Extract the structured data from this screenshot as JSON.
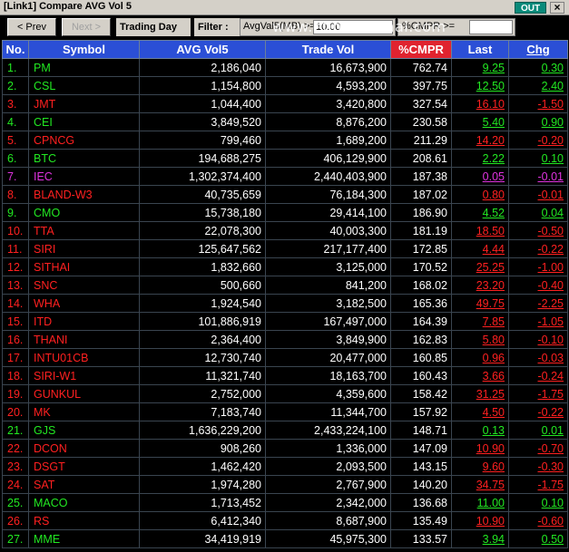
{
  "window": {
    "title": "[Link1] Compare AVG Vol 5",
    "out_label": "OUT",
    "close_label": "×"
  },
  "toolbar": {
    "prev_label": "< Prev",
    "next_label": "Next >",
    "trading_day_label": "Trading Day",
    "filter_label": "Filter :",
    "filter_field": "AvgVal5(MB) >=",
    "filter_value": "10.00",
    "cmpr_label": "%CMPR >=",
    "cmpr_value": "",
    "watermark": "www.efinancethai.com"
  },
  "colors": {
    "up": "#22e822",
    "down": "#ff2020",
    "floor": "#e033e0",
    "header": "#2b4fd6",
    "sorted_header": "#e0232f"
  },
  "table": {
    "headers": {
      "no": "No.",
      "symbol": "Symbol",
      "avg_vol5": "AVG Vol5",
      "trade_vol": "Trade Vol",
      "cmpr": "%CMPR",
      "last": "Last",
      "chg": "Chg"
    },
    "rows": [
      {
        "no": "1.",
        "symbol": "PM",
        "avg": "2,186,040",
        "vol": "16,673,900",
        "cmpr": "762.74",
        "last": "9.25",
        "chg": "0.30",
        "dir": "up"
      },
      {
        "no": "2.",
        "symbol": "CSL",
        "avg": "1,154,800",
        "vol": "4,593,200",
        "cmpr": "397.75",
        "last": "12.50",
        "chg": "2.40",
        "dir": "up"
      },
      {
        "no": "3.",
        "symbol": "JMT",
        "avg": "1,044,400",
        "vol": "3,420,800",
        "cmpr": "327.54",
        "last": "16.10",
        "chg": "-1.50",
        "dir": "down"
      },
      {
        "no": "4.",
        "symbol": "CEI",
        "avg": "3,849,520",
        "vol": "8,876,200",
        "cmpr": "230.58",
        "last": "5.40",
        "chg": "0.90",
        "dir": "up"
      },
      {
        "no": "5.",
        "symbol": "CPNCG",
        "avg": "799,460",
        "vol": "1,689,200",
        "cmpr": "211.29",
        "last": "14.20",
        "chg": "-0.20",
        "dir": "down"
      },
      {
        "no": "6.",
        "symbol": "BTC",
        "avg": "194,688,275",
        "vol": "406,129,900",
        "cmpr": "208.61",
        "last": "2.22",
        "chg": "0.10",
        "dir": "up"
      },
      {
        "no": "7.",
        "symbol": "IEC",
        "avg": "1,302,374,400",
        "vol": "2,440,403,900",
        "cmpr": "187.38",
        "last": "0.05",
        "chg": "-0.01",
        "dir": "floor"
      },
      {
        "no": "8.",
        "symbol": "BLAND-W3",
        "avg": "40,735,659",
        "vol": "76,184,300",
        "cmpr": "187.02",
        "last": "0.80",
        "chg": "-0.01",
        "dir": "down"
      },
      {
        "no": "9.",
        "symbol": "CMO",
        "avg": "15,738,180",
        "vol": "29,414,100",
        "cmpr": "186.90",
        "last": "4.52",
        "chg": "0.04",
        "dir": "up"
      },
      {
        "no": "10.",
        "symbol": "TTA",
        "avg": "22,078,300",
        "vol": "40,003,300",
        "cmpr": "181.19",
        "last": "18.50",
        "chg": "-0.50",
        "dir": "down"
      },
      {
        "no": "11.",
        "symbol": "SIRI",
        "avg": "125,647,562",
        "vol": "217,177,400",
        "cmpr": "172.85",
        "last": "4.44",
        "chg": "-0.22",
        "dir": "down"
      },
      {
        "no": "12.",
        "symbol": "SITHAI",
        "avg": "1,832,660",
        "vol": "3,125,000",
        "cmpr": "170.52",
        "last": "25.25",
        "chg": "-1.00",
        "dir": "down"
      },
      {
        "no": "13.",
        "symbol": "SNC",
        "avg": "500,660",
        "vol": "841,200",
        "cmpr": "168.02",
        "last": "23.20",
        "chg": "-0.40",
        "dir": "down"
      },
      {
        "no": "14.",
        "symbol": "WHA",
        "avg": "1,924,540",
        "vol": "3,182,500",
        "cmpr": "165.36",
        "last": "49.75",
        "chg": "-2.25",
        "dir": "down"
      },
      {
        "no": "15.",
        "symbol": "ITD",
        "avg": "101,886,919",
        "vol": "167,497,000",
        "cmpr": "164.39",
        "last": "7.85",
        "chg": "-1.05",
        "dir": "down"
      },
      {
        "no": "16.",
        "symbol": "THANI",
        "avg": "2,364,400",
        "vol": "3,849,900",
        "cmpr": "162.83",
        "last": "5.80",
        "chg": "-0.10",
        "dir": "down"
      },
      {
        "no": "17.",
        "symbol": "INTU01CB",
        "avg": "12,730,740",
        "vol": "20,477,000",
        "cmpr": "160.85",
        "last": "0.96",
        "chg": "-0.03",
        "dir": "down"
      },
      {
        "no": "18.",
        "symbol": "SIRI-W1",
        "avg": "11,321,740",
        "vol": "18,163,700",
        "cmpr": "160.43",
        "last": "3.66",
        "chg": "-0.24",
        "dir": "down"
      },
      {
        "no": "19.",
        "symbol": "GUNKUL",
        "avg": "2,752,000",
        "vol": "4,359,600",
        "cmpr": "158.42",
        "last": "31.25",
        "chg": "-1.75",
        "dir": "down"
      },
      {
        "no": "20.",
        "symbol": "MK",
        "avg": "7,183,740",
        "vol": "11,344,700",
        "cmpr": "157.92",
        "last": "4.50",
        "chg": "-0.22",
        "dir": "down"
      },
      {
        "no": "21.",
        "symbol": "GJS",
        "avg": "1,636,229,200",
        "vol": "2,433,224,100",
        "cmpr": "148.71",
        "last": "0.13",
        "chg": "0.01",
        "dir": "up"
      },
      {
        "no": "22.",
        "symbol": "DCON",
        "avg": "908,260",
        "vol": "1,336,000",
        "cmpr": "147.09",
        "last": "10.90",
        "chg": "-0.70",
        "dir": "down"
      },
      {
        "no": "23.",
        "symbol": "DSGT",
        "avg": "1,462,420",
        "vol": "2,093,500",
        "cmpr": "143.15",
        "last": "9.60",
        "chg": "-0.30",
        "dir": "down"
      },
      {
        "no": "24.",
        "symbol": "SAT",
        "avg": "1,974,280",
        "vol": "2,767,900",
        "cmpr": "140.20",
        "last": "34.75",
        "chg": "-1.75",
        "dir": "down"
      },
      {
        "no": "25.",
        "symbol": "MACO",
        "avg": "1,713,452",
        "vol": "2,342,000",
        "cmpr": "136.68",
        "last": "11.00",
        "chg": "0.10",
        "dir": "up"
      },
      {
        "no": "26.",
        "symbol": "RS",
        "avg": "6,412,340",
        "vol": "8,687,900",
        "cmpr": "135.49",
        "last": "10.90",
        "chg": "-0.60",
        "dir": "down"
      },
      {
        "no": "27.",
        "symbol": "MME",
        "avg": "34,419,919",
        "vol": "45,975,300",
        "cmpr": "133.57",
        "last": "3.94",
        "chg": "0.50",
        "dir": "up"
      }
    ]
  }
}
